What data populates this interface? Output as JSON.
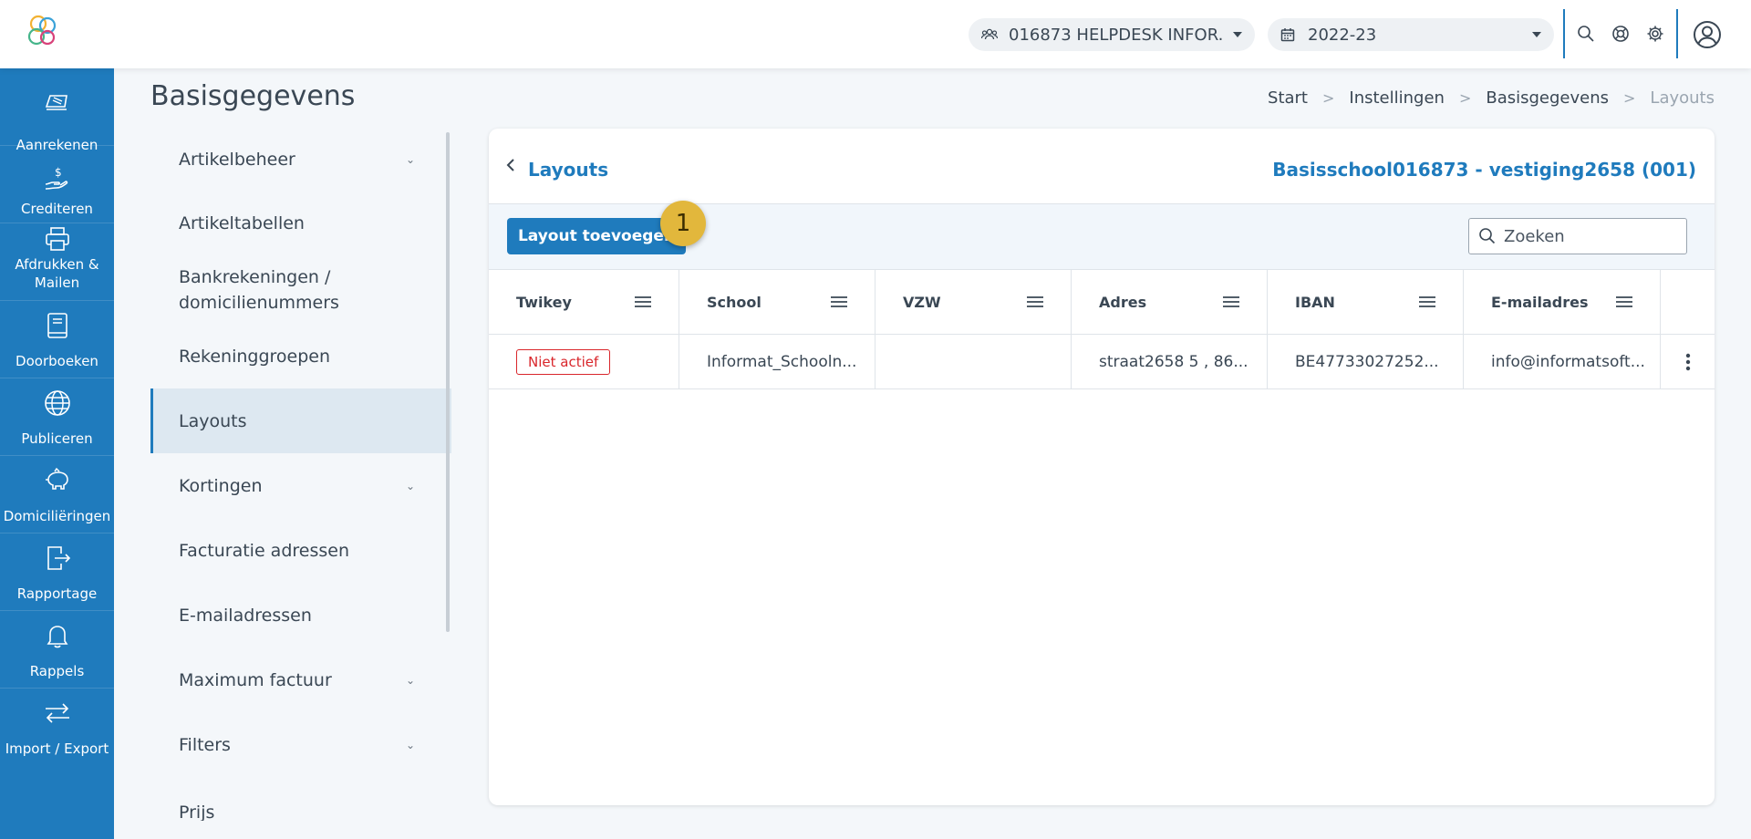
{
  "topbar": {
    "school_selector": "016873 HELPDESK INFOR...",
    "year_selector": "2022-23"
  },
  "rail": {
    "items": [
      {
        "label": "Aanrekenen",
        "icon": "invoice-icon"
      },
      {
        "label": "Crediteren",
        "icon": "hand-dollar-icon"
      },
      {
        "label": "Afdrukken & Mailen",
        "icon": "printer-icon"
      },
      {
        "label": "Doorboeken",
        "icon": "book-icon"
      },
      {
        "label": "Publiceren",
        "icon": "globe-icon"
      },
      {
        "label": "Domiciliëringen",
        "icon": "piggy-bank-icon"
      },
      {
        "label": "Rapportage",
        "icon": "export-file-icon"
      },
      {
        "label": "Rappels",
        "icon": "bell-icon"
      },
      {
        "label": "Import / Export",
        "icon": "transfer-arrows-icon"
      }
    ]
  },
  "page": {
    "title": "Basisgegevens"
  },
  "breadcrumb": {
    "items": [
      "Start",
      "Instellingen",
      "Basisgegevens",
      "Layouts"
    ]
  },
  "subnav": {
    "items": [
      {
        "label": "Artikelbeheer",
        "has_children": true
      },
      {
        "label": "Artikeltabellen",
        "has_children": false
      },
      {
        "label": "Bankrekeningen / domicilienummers",
        "has_children": false
      },
      {
        "label": "Rekeninggroepen",
        "has_children": false
      },
      {
        "label": "Layouts",
        "has_children": false,
        "active": true
      },
      {
        "label": "Kortingen",
        "has_children": true
      },
      {
        "label": "Facturatie adressen",
        "has_children": false
      },
      {
        "label": "E-mailadressen",
        "has_children": false
      },
      {
        "label": "Maximum factuur",
        "has_children": true
      },
      {
        "label": "Filters",
        "has_children": true
      },
      {
        "label": "Prijs",
        "has_children": false
      }
    ]
  },
  "card": {
    "title": "Layouts",
    "school_label": "Basisschool016873 - vestiging2658 (001)",
    "add_button": "Layout toevoegen",
    "step_badge": "1",
    "search_placeholder": "Zoeken"
  },
  "table": {
    "columns": [
      "Twikey",
      "School",
      "VZW",
      "Adres",
      "IBAN",
      "E-mailadres"
    ],
    "rows": [
      {
        "twikey": "Niet actief",
        "school": "Informat_Schooln...",
        "vzw": "",
        "adres": "straat2658 5 , 86...",
        "iban": "BE47733027252...",
        "email": "info@informatsoft..."
      }
    ]
  },
  "colors": {
    "primary": "#1f7bbd",
    "status_inactive": "#d9262b",
    "badge": "#e2b73c"
  }
}
